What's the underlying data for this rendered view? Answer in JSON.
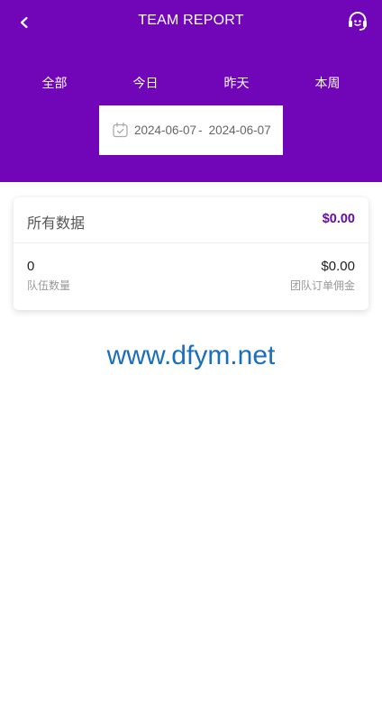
{
  "header": {
    "title": "TEAM REPORT",
    "background_color": "#7006b8",
    "back_icon": "chevron-left-icon",
    "support_icon": "headset-icon"
  },
  "tabs": [
    {
      "label": "全部"
    },
    {
      "label": "今日"
    },
    {
      "label": "昨天"
    },
    {
      "label": "本周"
    }
  ],
  "date_range": {
    "icon": "calendar-check-icon",
    "start": "2024-06-07",
    "separator": "-",
    "end": "2024-06-07"
  },
  "summary_card": {
    "title": "所有数据",
    "total": "$0.00",
    "accent_color": "#6a0aa8",
    "stats": [
      {
        "value": "0",
        "label": "队伍数量"
      },
      {
        "value": "$0.00",
        "label": "团队订单佣金"
      }
    ]
  },
  "watermark": "www.dfym.net"
}
